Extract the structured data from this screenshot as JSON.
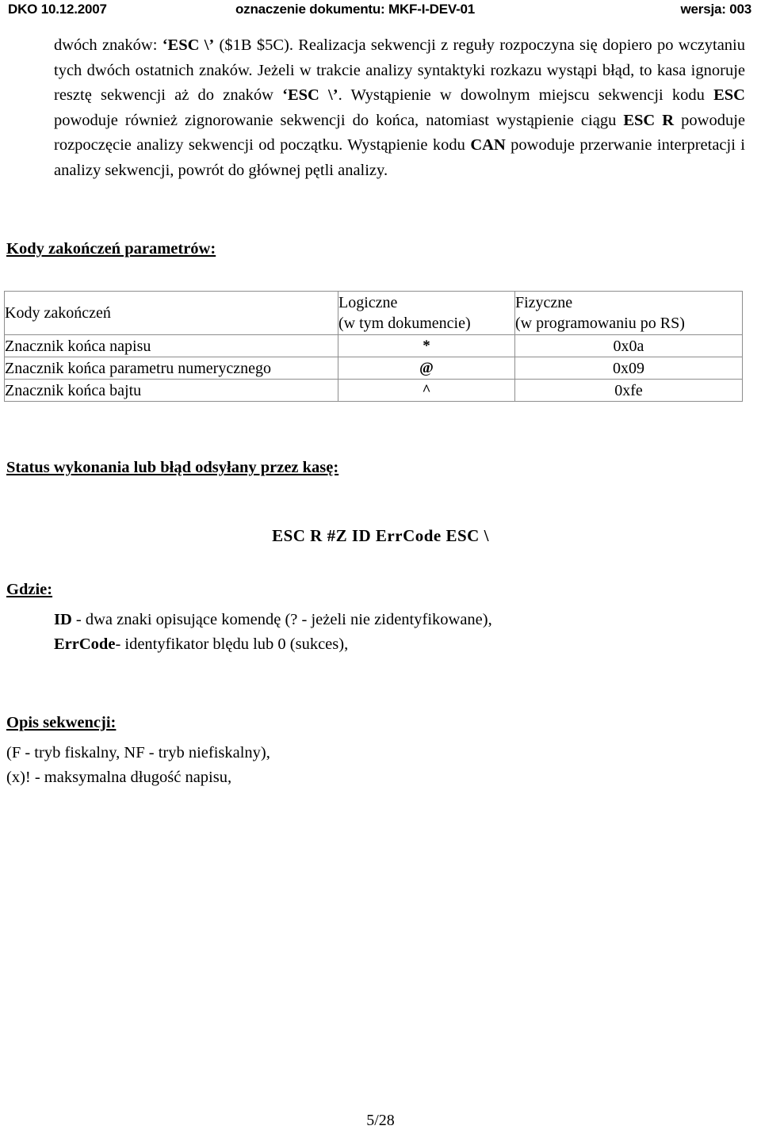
{
  "header": {
    "left": "DKO  10.12.2007",
    "center": "oznaczenie dokumentu: MKF-I-DEV-01",
    "right": "wersja: 003"
  },
  "paragraph": {
    "part1": "dwóch znaków: ",
    "bold1": "‘ESC \\’",
    "part2": " ($1B $5C). Realizacja sekwencji z reguły rozpoczyna się dopiero po wczytaniu tych dwóch ostatnich znaków. Jeżeli w trakcie analizy syntaktyki rozkazu wystąpi błąd, to kasa ignoruje resztę sekwencji aż do znaków ",
    "bold2": "‘ESC \\’",
    "part3": ". Wystąpienie w dowolnym miejscu sekwencji kodu ",
    "bold3": "ESC",
    "part4": " powoduje również zignorowanie sekwencji do końca, natomiast wystąpienie ciągu ",
    "bold4": "ESC R",
    "part5": " powoduje rozpoczęcie analizy sekwencji od początku. Wystąpienie kodu ",
    "bold5": "CAN",
    "part6": " powoduje przerwanie interpretacji i analizy sekwencji, powrót do głównej pętli analizy."
  },
  "sections": {
    "codes_heading": "Kody zakończeń parametrów:",
    "status_heading": "Status wykonania lub błąd odsyłany przez kasę:",
    "gdzie_heading": "Gdzie:",
    "opis_heading": "Opis sekwencji:"
  },
  "table": {
    "headers": {
      "col1": "Kody zakończeń",
      "col2_line1": "Logiczne",
      "col2_line2": "(w tym dokumencie)",
      "col3_line1": "Fizyczne",
      "col3_line2": "(w programowaniu po RS)"
    },
    "rows": [
      {
        "name": "Znacznik końca napisu",
        "logical": "*",
        "physical": "0x0a"
      },
      {
        "name": "Znacznik końca parametru numerycznego",
        "logical": "@",
        "physical": "0x09"
      },
      {
        "name": "Znacznik końca bajtu",
        "logical": "^",
        "physical": "0xfe"
      }
    ]
  },
  "status_code_line": "ESC  R  #Z  ID  ErrCode  ESC  \\",
  "definitions": [
    {
      "term": "ID",
      "desc": " - dwa znaki opisujące komendę (? - jeżeli nie zidentyfikowane),"
    },
    {
      "term": "ErrCode",
      "desc": "- identyfikator blędu lub 0 (sukces),"
    }
  ],
  "opis_lines": [
    "(F - tryb fiskalny, NF - tryb niefiskalny),",
    "(x)!  - maksymalna długość napisu,"
  ],
  "footer": {
    "page": "5/28"
  }
}
